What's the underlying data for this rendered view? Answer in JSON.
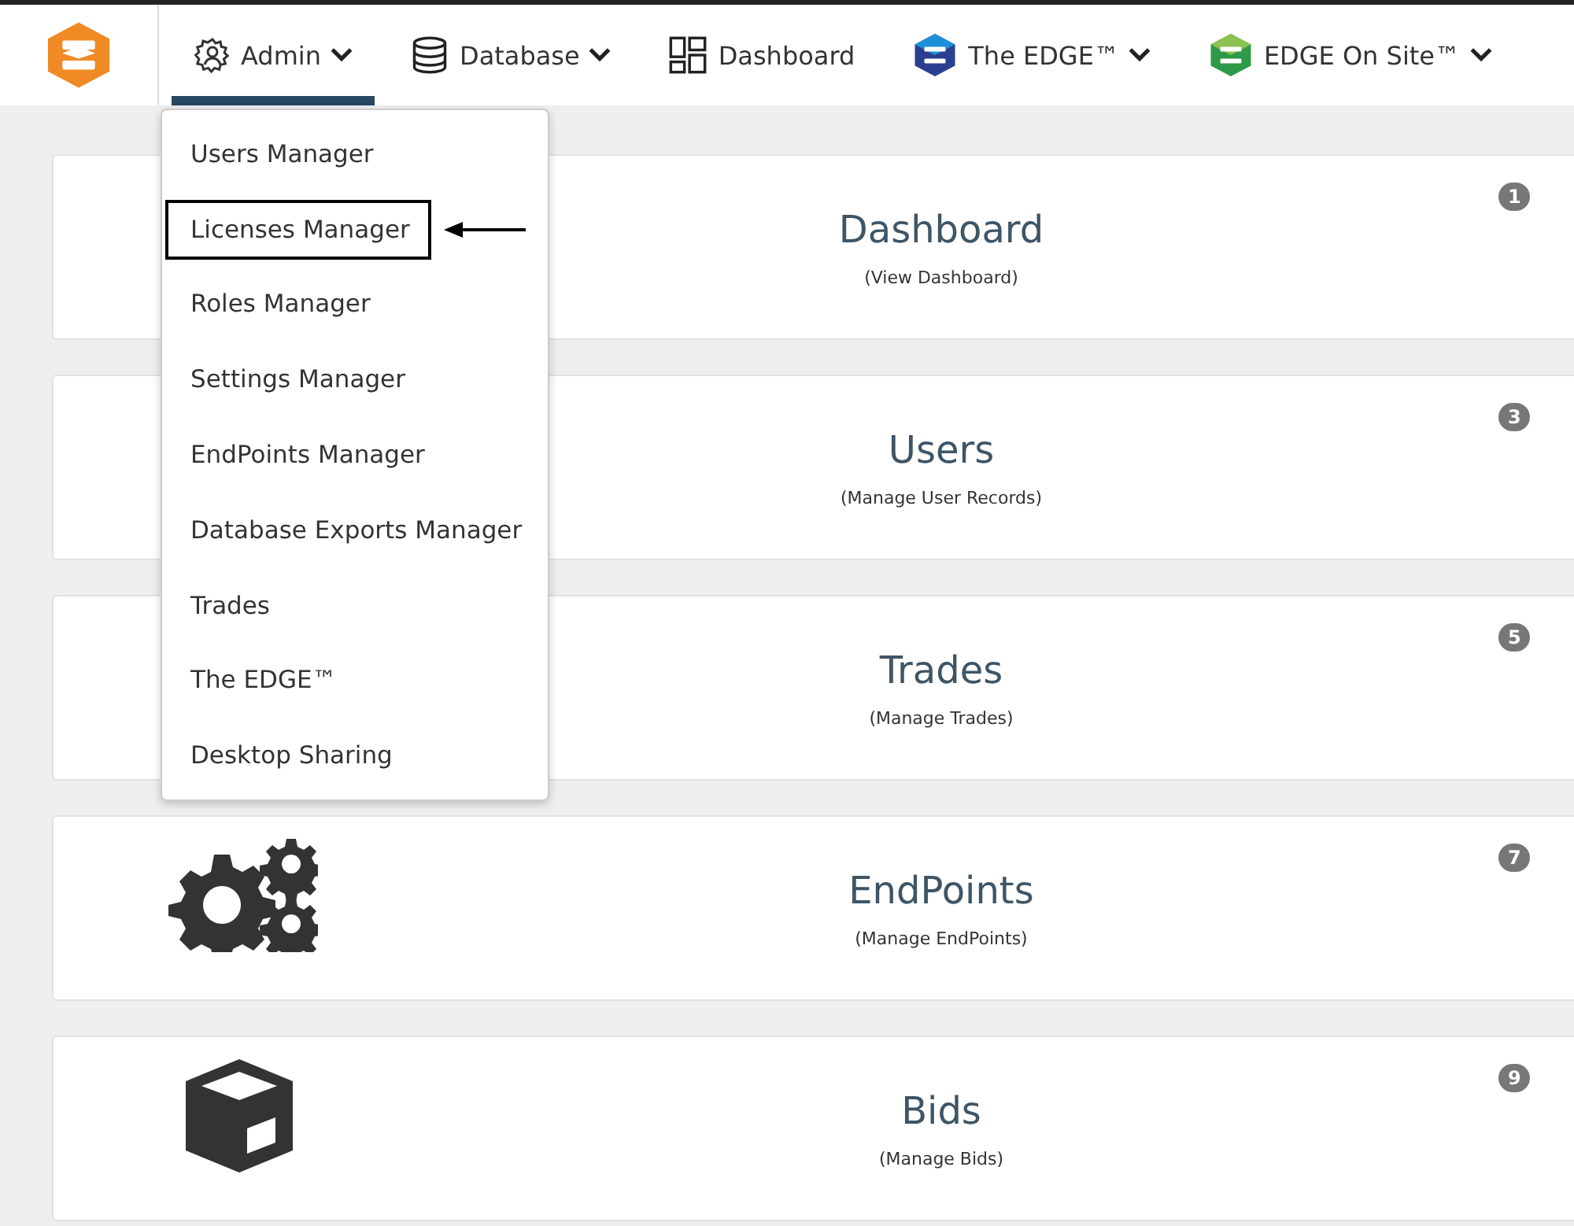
{
  "nav": [
    {
      "label": "Admin",
      "kind": "gear",
      "has_menu": true,
      "selected": true
    },
    {
      "label": "Database",
      "kind": "database",
      "has_menu": true,
      "selected": false
    },
    {
      "label": "Dashboard",
      "kind": "grid",
      "has_menu": false,
      "selected": false
    },
    {
      "label": "The EDGE™",
      "kind": "edge-blue",
      "has_menu": true,
      "selected": false
    },
    {
      "label": "EDGE On Site™",
      "kind": "edge-green",
      "has_menu": true,
      "selected": false
    }
  ],
  "menu": [
    {
      "label": "Users Manager",
      "highlighted": false
    },
    {
      "label": "Licenses Manager",
      "highlighted": true
    },
    {
      "label": "Roles Manager",
      "highlighted": false
    },
    {
      "label": "Settings Manager",
      "highlighted": false
    },
    {
      "label": "EndPoints Manager",
      "highlighted": false
    },
    {
      "label": "Database Exports Manager",
      "highlighted": false
    },
    {
      "label": "Trades",
      "highlighted": false
    },
    {
      "label": "The EDGE™",
      "highlighted": false
    },
    {
      "label": "Desktop Sharing",
      "highlighted": false
    }
  ],
  "cards": [
    {
      "title": "Dashboard",
      "subtitle": "(View Dashboard)",
      "badge": "1",
      "kind": "plain"
    },
    {
      "title": "Users",
      "subtitle": "(Manage User Records)",
      "badge": "3",
      "kind": "plain"
    },
    {
      "title": "Trades",
      "subtitle": "(Manage Trades)",
      "badge": "5",
      "kind": "plain"
    },
    {
      "title": "EndPoints",
      "subtitle": "(Manage EndPoints)",
      "badge": "7",
      "kind": "gears"
    },
    {
      "title": "Bids",
      "subtitle": "(Manage Bids)",
      "badge": "9",
      "kind": "cube"
    }
  ]
}
